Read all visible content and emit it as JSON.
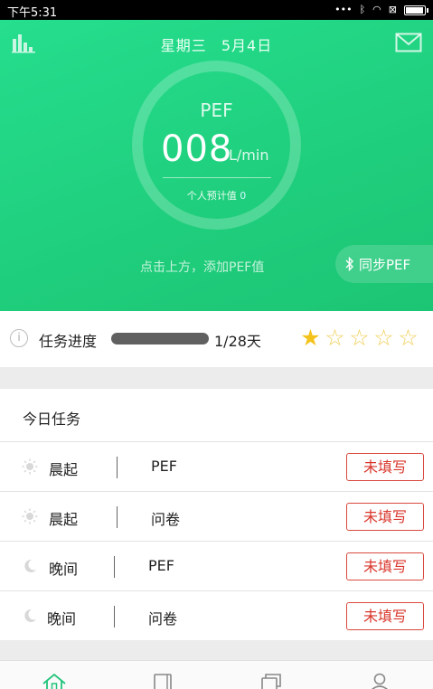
{
  "status_bar": {
    "time": "下午5:31"
  },
  "header": {
    "weekday": "星期三",
    "date": "5月4日",
    "metric_label": "PEF",
    "value": "008",
    "unit": "L/min",
    "predicted_label": "个人预计值",
    "predicted_value": "0",
    "hint": "点击上方，添加PEF值",
    "sync_label": "同步PEF"
  },
  "progress": {
    "label": "任务进度",
    "fraction": 0.0357,
    "text": "1/28天",
    "stars_filled": 1,
    "stars_total": 5
  },
  "today_tasks": {
    "title": "今日任务",
    "rows": [
      {
        "icon": "sun-icon",
        "period": "晨起",
        "type": "PEF",
        "status": "未填写"
      },
      {
        "icon": "sun-icon",
        "period": "晨起",
        "type": "问卷",
        "status": "未填写"
      },
      {
        "icon": "moon-icon",
        "period": "晚间",
        "type": "PEF",
        "status": "未填写"
      },
      {
        "icon": "moon-icon",
        "period": "晚间",
        "type": "问卷",
        "status": "未填写"
      }
    ]
  },
  "bottom_nav": {
    "items": [
      {
        "icon": "home-icon"
      },
      {
        "icon": "book-icon"
      },
      {
        "icon": "copy-icon"
      },
      {
        "icon": "person-icon"
      }
    ]
  },
  "colors": {
    "accent_green": "#22d486",
    "status_red": "#d9362b",
    "star_gold": "#f3c21b"
  }
}
